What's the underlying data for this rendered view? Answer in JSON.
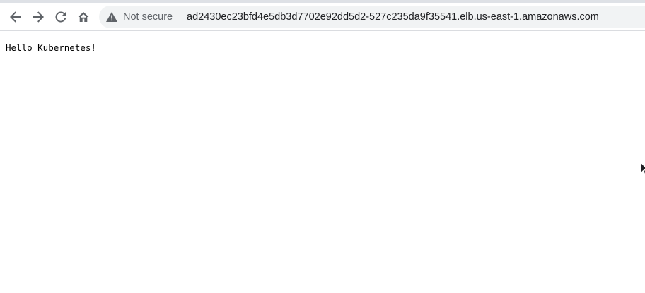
{
  "browser": {
    "nav": {
      "back_icon": "arrow-left-icon",
      "forward_icon": "arrow-right-icon",
      "reload_icon": "reload-icon",
      "home_icon": "home-icon"
    },
    "omnibox": {
      "security_icon": "warning-triangle-icon",
      "security_label": "Not secure",
      "url": "ad2430ec23bfd4e5db3d7702e92dd5d2-527c235da9f35541.elb.us-east-1.amazonaws.com"
    }
  },
  "page": {
    "body_text": "Hello Kubernetes!"
  },
  "colors": {
    "toolbar_bg": "#ffffff",
    "omnibox_bg": "#f1f3f4",
    "icon_color": "#5f6368",
    "url_text": "#202124"
  }
}
